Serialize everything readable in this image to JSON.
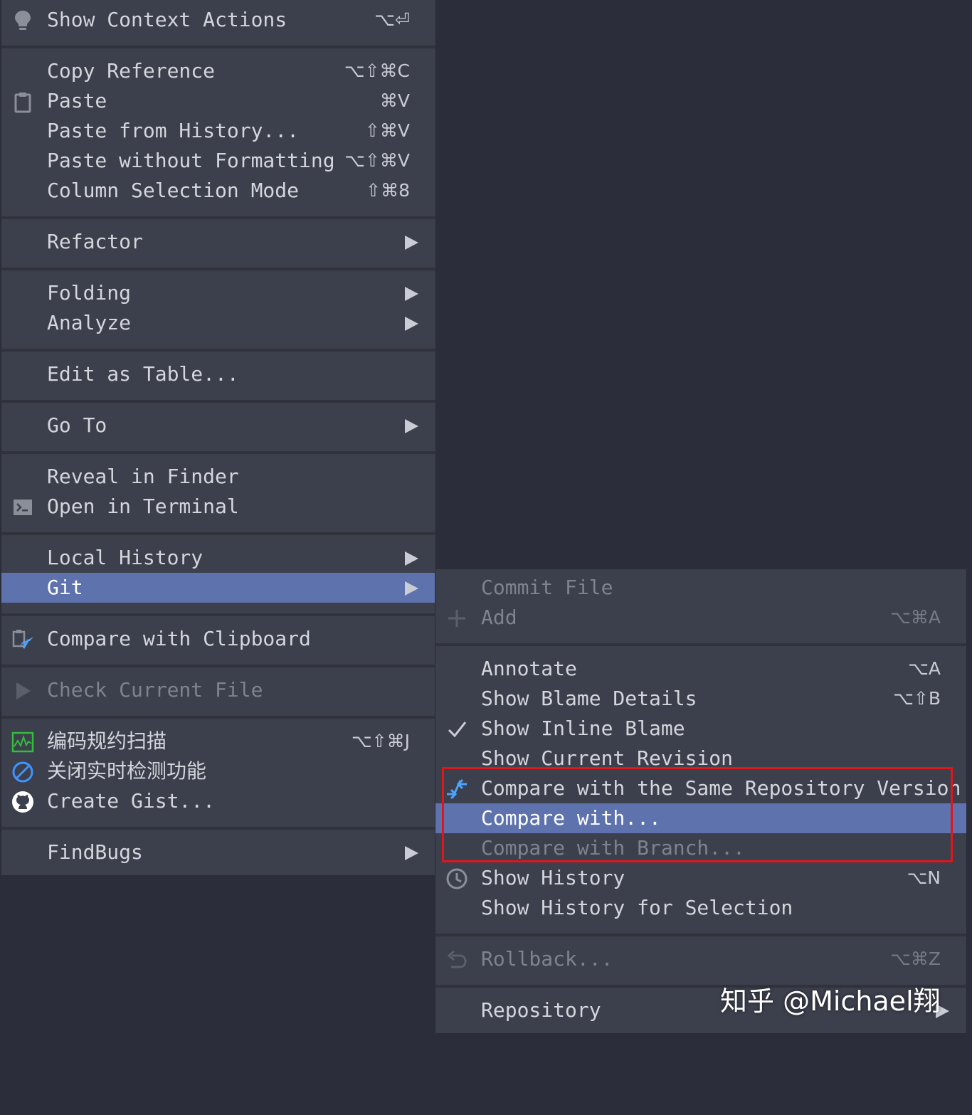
{
  "main_menu": {
    "items": [
      {
        "label": "Show Context Actions",
        "shortcut": "⌥⏎",
        "icon": "lightbulb-icon"
      },
      {
        "label": "Copy Reference",
        "shortcut": "⌥⇧⌘C"
      },
      {
        "label": "Paste",
        "shortcut": "⌘V",
        "icon": "clipboard-icon"
      },
      {
        "label": "Paste from History...",
        "shortcut": "⇧⌘V"
      },
      {
        "label": "Paste without Formatting",
        "shortcut": "⌥⇧⌘V"
      },
      {
        "label": "Column Selection Mode",
        "shortcut": "⇧⌘8"
      },
      {
        "label": "Refactor",
        "submenu": true
      },
      {
        "label": "Folding",
        "submenu": true
      },
      {
        "label": "Analyze",
        "submenu": true
      },
      {
        "label": "Edit as Table..."
      },
      {
        "label": "Go To",
        "submenu": true
      },
      {
        "label": "Reveal in Finder"
      },
      {
        "label": "Open in Terminal",
        "icon": "terminal-icon"
      },
      {
        "label": "Local History",
        "submenu": true
      },
      {
        "label": "Git",
        "submenu": true,
        "selected": true
      },
      {
        "label": "Compare with Clipboard",
        "icon": "compare-clipboard-icon"
      },
      {
        "label": "Check Current File",
        "icon": "play-icon",
        "disabled": true
      },
      {
        "label": "编码规约扫描",
        "shortcut": "⌥⇧⌘J",
        "icon": "scan-chart-icon"
      },
      {
        "label": "关闭实时检测功能",
        "icon": "prohibited-icon"
      },
      {
        "label": "Create Gist...",
        "icon": "github-icon"
      },
      {
        "label": "FindBugs",
        "submenu": true
      }
    ]
  },
  "git_menu": {
    "items": [
      {
        "label": "Commit File",
        "disabled": true
      },
      {
        "label": "Add",
        "shortcut": "⌥⌘A",
        "icon": "plus-icon",
        "disabled": true
      },
      {
        "label": "Annotate",
        "shortcut": "⌥A"
      },
      {
        "label": "Show Blame Details",
        "shortcut": "⌥⇧B"
      },
      {
        "label": "Show Inline Blame",
        "icon": "checkmark-icon",
        "checked": true
      },
      {
        "label": "Show Current Revision"
      },
      {
        "label": "Compare with the Same Repository Version",
        "icon": "compare-arrows-icon"
      },
      {
        "label": "Compare with...",
        "selected": true
      },
      {
        "label": "Compare with Branch...",
        "disabled": true
      },
      {
        "label": "Show History",
        "shortcut": "⌥N",
        "icon": "clock-icon"
      },
      {
        "label": "Show History for Selection"
      },
      {
        "label": "Rollback...",
        "shortcut": "⌥⌘Z",
        "icon": "undo-icon",
        "disabled": true
      },
      {
        "label": "Repository",
        "submenu": true
      }
    ]
  },
  "watermark": "知乎 @Michael翔",
  "colors": {
    "background": "#2b2d3a",
    "menu": "#3c3f4c",
    "selection": "#5e72ae",
    "highlight_box": "#e0161b"
  }
}
